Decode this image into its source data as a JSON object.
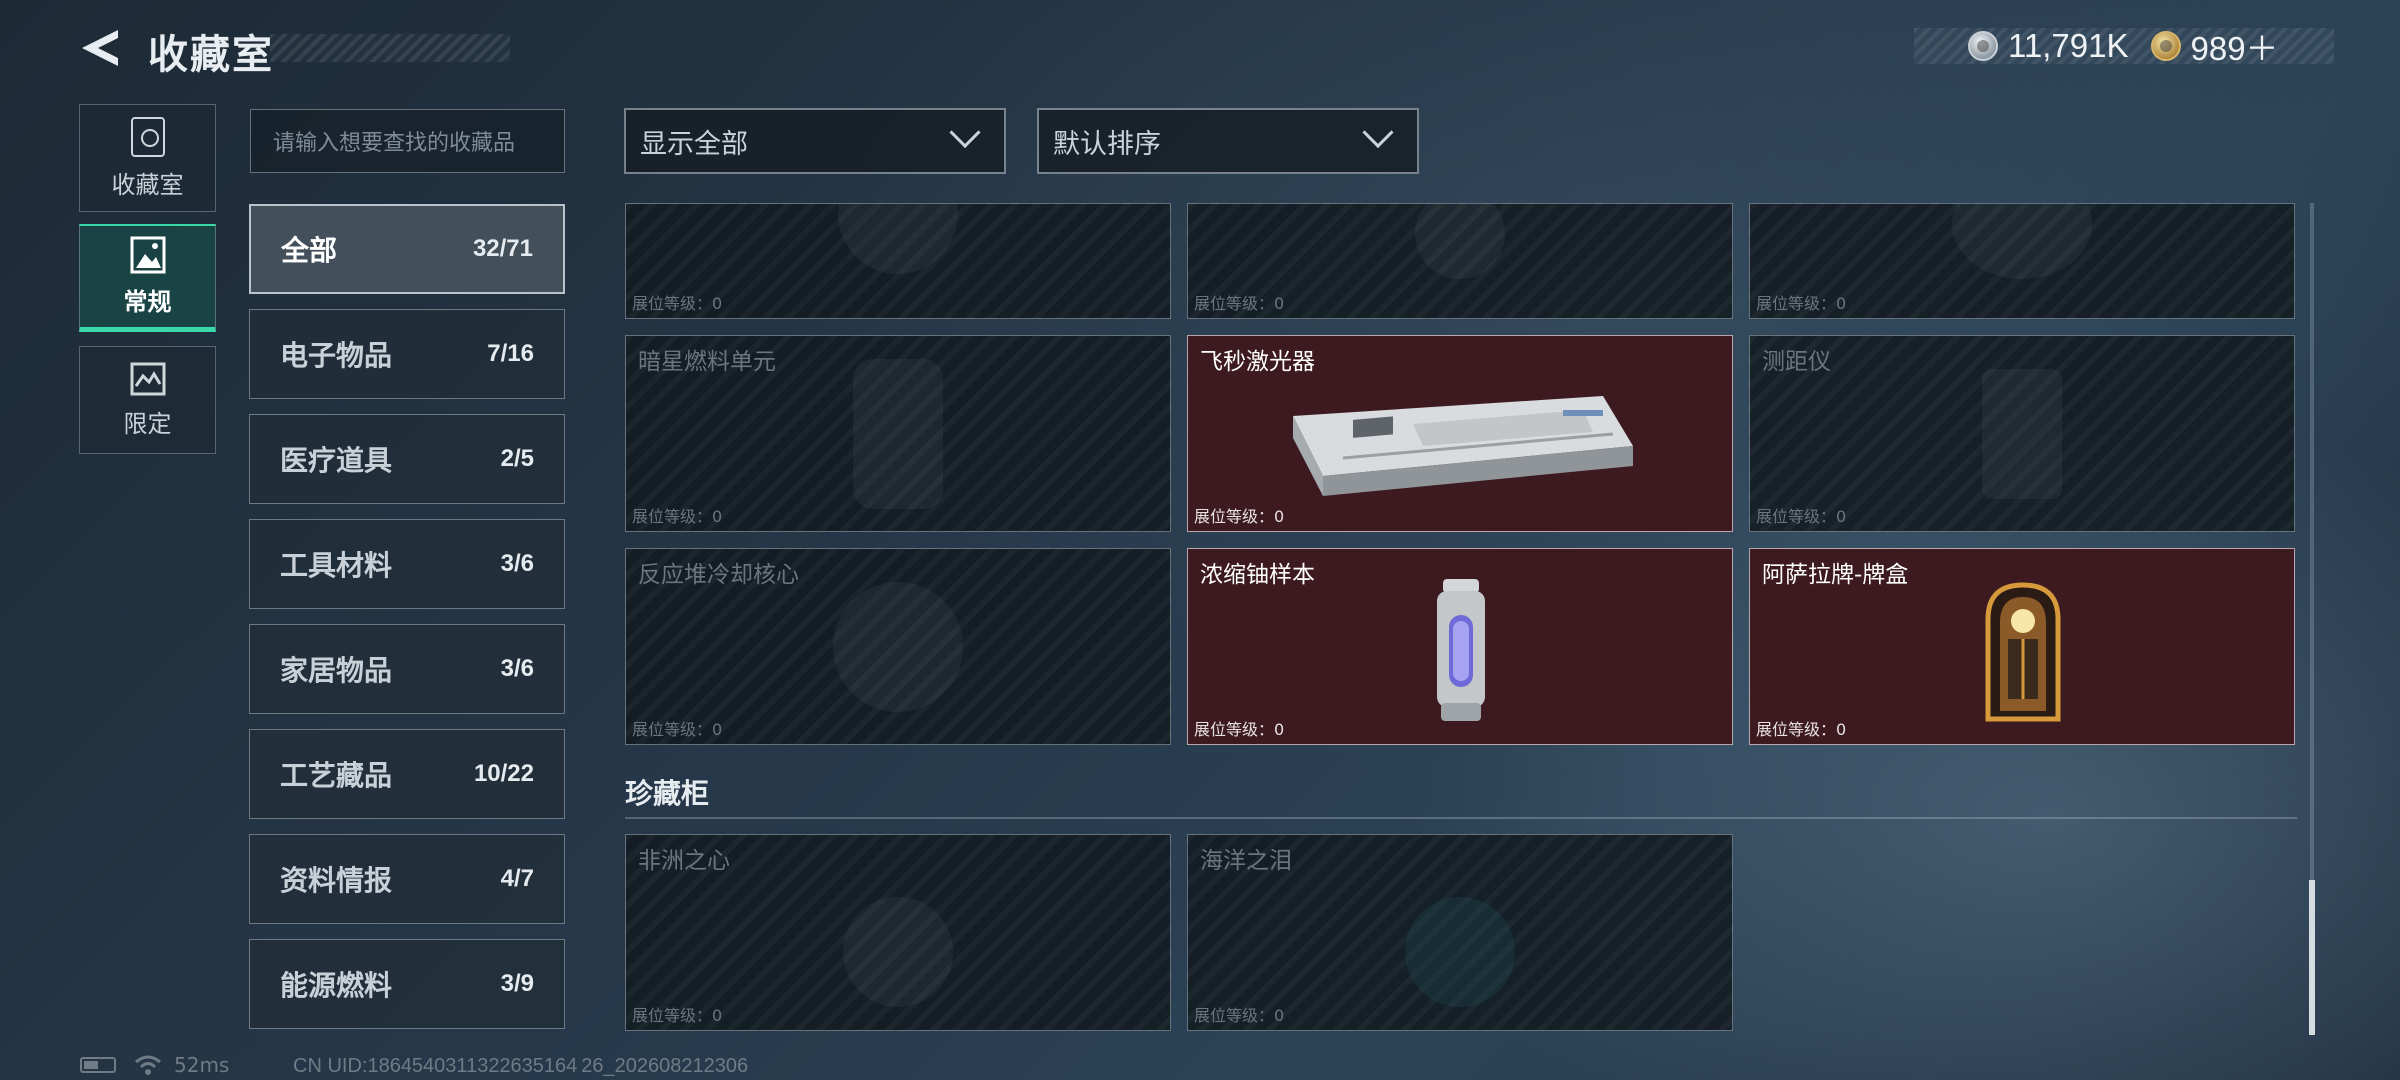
{
  "header": {
    "title": "收藏室",
    "currency_silver": "11,791K",
    "currency_gold": "989＋"
  },
  "nav": [
    {
      "label": "收藏室",
      "active": false
    },
    {
      "label": "常规",
      "active": true
    },
    {
      "label": "限定",
      "active": false
    }
  ],
  "search": {
    "placeholder": "请输入想要查找的收藏品"
  },
  "categories": [
    {
      "label": "全部",
      "count": "32/71",
      "selected": true
    },
    {
      "label": "电子物品",
      "count": "7/16"
    },
    {
      "label": "医疗道具",
      "count": "2/5"
    },
    {
      "label": "工具材料",
      "count": "3/6"
    },
    {
      "label": "家居物品",
      "count": "3/6"
    },
    {
      "label": "工艺藏品",
      "count": "10/22"
    },
    {
      "label": "资料情报",
      "count": "4/7"
    },
    {
      "label": "能源燃料",
      "count": "3/9"
    }
  ],
  "filters": {
    "display": "显示全部",
    "sort": "默认排序"
  },
  "level_label": "展位等级：0",
  "cards_row1": [
    {
      "name": "",
      "owned": false
    },
    {
      "name": "",
      "owned": false
    },
    {
      "name": "",
      "owned": false
    }
  ],
  "cards_row2": [
    {
      "name": "暗星燃料单元",
      "owned": false
    },
    {
      "name": "飞秒激光器",
      "owned": true
    },
    {
      "name": "测距仪",
      "owned": false
    }
  ],
  "cards_row3": [
    {
      "name": "反应堆冷却核心",
      "owned": false
    },
    {
      "name": "浓缩铀样本",
      "owned": true
    },
    {
      "name": "阿萨拉牌-牌盒",
      "owned": true
    }
  ],
  "section2_title": "珍藏柜",
  "cards_row4": [
    {
      "name": "非洲之心",
      "owned": false
    },
    {
      "name": "海洋之泪",
      "owned": false
    }
  ],
  "status": {
    "ping": "52ms",
    "uid": "CN UID:1864540311322635164 26_202608212306"
  },
  "colors": {
    "accent": "#3ad7a8",
    "owned_card": "#3c1a20"
  }
}
